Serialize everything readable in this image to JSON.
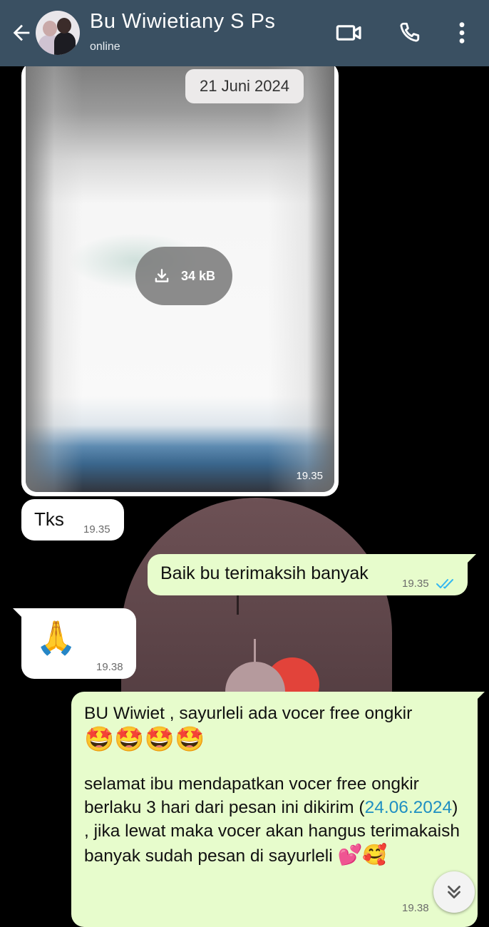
{
  "header": {
    "contact_name": "Bu Wiwietiany S Ps",
    "status": "online"
  },
  "date_chip": "21 Juni 2024",
  "messages": [
    {
      "type": "image",
      "direction": "incoming",
      "file_size": "34 kB",
      "time": "19.35"
    },
    {
      "type": "text",
      "direction": "incoming",
      "text": "Tks",
      "time": "19.35"
    },
    {
      "type": "text",
      "direction": "outgoing",
      "text": "Baik bu terimaksih banyak",
      "time": "19.35",
      "status": "read"
    },
    {
      "type": "emoji",
      "direction": "incoming",
      "text": "🙏",
      "time": "19.38"
    },
    {
      "type": "text",
      "direction": "outgoing",
      "time": "19.38",
      "status": "read",
      "line1": "BU Wiwiet , sayurleli ada vocer free ongkir",
      "emoji_line": "🤩🤩🤩🤩",
      "line2": "selamat ibu mendapatkan vocer free ongkir berlaku 3 hari dari pesan ini dikirim",
      "date_link": "24.06.2024",
      "line3": ") , jika lewat maka vocer akan hangus terimakaish banyak sudah pesan di sayurleli",
      "open_paren": "(",
      "end_emojis": "💕🥰"
    }
  ],
  "colors": {
    "header_bg": "#3a5062",
    "outgoing_bubble": "#e7fccc",
    "incoming_bubble": "#ffffff",
    "read_ticks": "#34b7f1",
    "link": "#1f8fc2"
  }
}
